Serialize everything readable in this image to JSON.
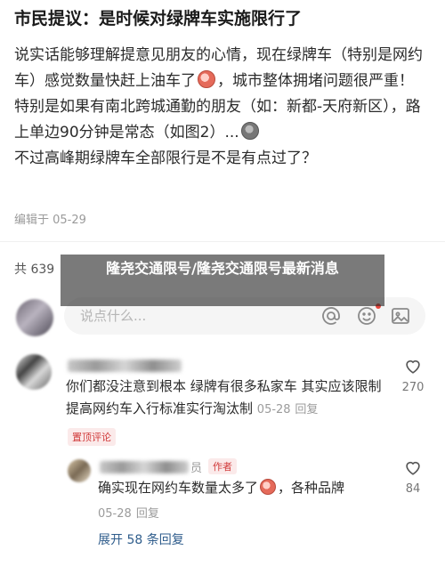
{
  "post": {
    "title": "市民提议：是时候对绿牌车实施限行了",
    "paragraphs": [
      "说实话能够理解提意见朋友的心情，现在绿牌车（特别是网约车）感觉数量快赶上油车了",
      "，城市整体拥堵问题很严重！",
      "特别是如果有南北跨城通勤的朋友（如：新都-天府新区），路上单边90分钟是常态（如图2）...",
      "不过高峰期绿牌车全部限行是不是有点过了？"
    ],
    "edited": "编辑于 05-29"
  },
  "comments_section": {
    "count_label": "共 639",
    "input_placeholder": "说点什么..."
  },
  "overlay": {
    "headline": "隆尧交通限号/隆尧交通限号最新消息"
  },
  "comments": [
    {
      "text": "你们都没注意到根本 绿牌有很多私家车 其实应该限制提高网约车入行标准实行淘汰制",
      "date": "05-28",
      "reply_label": "回复",
      "badge": "置顶评论",
      "likes": "270"
    }
  ],
  "replies": [
    {
      "name_suffix": "员",
      "author_tag": "作者",
      "text": "确实现在网约车数量太多了",
      "text_after": "，各种品牌",
      "date": "05-28",
      "reply_label": "回复",
      "likes": "84"
    }
  ],
  "expand_label": "展开 58 条回复",
  "icons": {
    "at": "at-icon",
    "emoji": "emoji-icon",
    "image": "image-icon",
    "heart": "heart-outline-icon"
  },
  "colors": {
    "accent_red": "#d13b3b",
    "link_blue": "#2f5d8c",
    "overlay_bg": "#282828"
  }
}
